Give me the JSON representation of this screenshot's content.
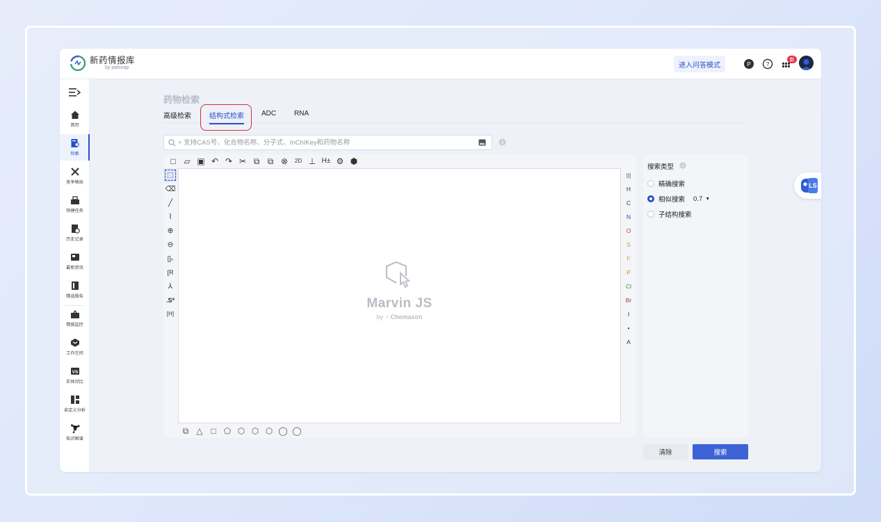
{
  "app": {
    "title": "新药情报库",
    "subtitle": "by patsnap",
    "qa_mode_button": "进入问答模式",
    "notification_badge": "新"
  },
  "sidebar": {
    "items": [
      {
        "label": "首页",
        "icon": "home-icon"
      },
      {
        "label": "检索",
        "icon": "search-doc-icon",
        "active": true
      },
      {
        "label": "竞争格局",
        "icon": "swords-icon"
      },
      {
        "label": "快捷任务",
        "icon": "task-icon"
      },
      {
        "label": "历史记录",
        "icon": "history-icon"
      },
      {
        "label": "最新资讯",
        "icon": "news-icon"
      },
      {
        "label": "精选报告",
        "icon": "report-icon"
      },
      {
        "label": "情报监控",
        "icon": "monitor-icon"
      },
      {
        "label": "工作空间",
        "icon": "workspace-icon"
      },
      {
        "label": "实体对比",
        "icon": "compare-icon"
      },
      {
        "label": "自定义分析",
        "icon": "dashboard-icon"
      },
      {
        "label": "知识图谱",
        "icon": "graph-icon"
      }
    ]
  },
  "page": {
    "title": "药物检索",
    "tabs": [
      {
        "label": "高级检索",
        "active": false
      },
      {
        "label": "结构式检索",
        "active": true
      },
      {
        "label": "ADC",
        "active": false
      },
      {
        "label": "RNA",
        "active": false
      }
    ],
    "search_placeholder": "+ 支持CAS号、化合物名称、分子式、InChIKey和药物名称"
  },
  "editor": {
    "watermark_title": "Marvin JS",
    "watermark_by": "by",
    "watermark_brand": "Chemaxon",
    "top_tools": [
      "□",
      "▱",
      "▣",
      "↶",
      "↷",
      "✂",
      "⧉",
      "⧉",
      "⊗",
      "2D",
      "⊥",
      "H±",
      "⚙",
      "⬢"
    ],
    "left_tools": [
      "⬚",
      "⌫",
      "╱",
      "⌇",
      "⊕",
      "⊖",
      "[]ₙ",
      "[R",
      "⅄",
      ".S*",
      "[H]"
    ],
    "elements": [
      {
        "symbol": "|||",
        "color": "#555555"
      },
      {
        "symbol": "H",
        "color": "#333333"
      },
      {
        "symbol": "C",
        "color": "#333333"
      },
      {
        "symbol": "N",
        "color": "#2b4fc8"
      },
      {
        "symbol": "O",
        "color": "#d9302a"
      },
      {
        "symbol": "S",
        "color": "#b8a42a"
      },
      {
        "symbol": "F",
        "color": "#d2a23c"
      },
      {
        "symbol": "P",
        "color": "#d08a2a"
      },
      {
        "symbol": "Cl",
        "color": "#2e9a3a"
      },
      {
        "symbol": "Br",
        "color": "#a23a2a"
      },
      {
        "symbol": "I",
        "color": "#333333"
      },
      {
        "symbol": "•",
        "color": "#333333"
      },
      {
        "symbol": "A",
        "color": "#333333"
      }
    ],
    "bottom_tools": [
      "⧉",
      "△",
      "□",
      "⬠",
      "⬡",
      "⬡",
      "⬡",
      "◯",
      "◯"
    ]
  },
  "search_type": {
    "title": "搜索类型",
    "options": [
      {
        "label": "精确搜索",
        "selected": false
      },
      {
        "label": "相似搜索",
        "selected": true,
        "value": "0.7"
      },
      {
        "label": "子结构搜索",
        "selected": false
      }
    ]
  },
  "actions": {
    "clear": "清除",
    "search": "搜索"
  },
  "colors": {
    "accent": "#2b4fc8",
    "highlight_border": "#c8333a"
  }
}
